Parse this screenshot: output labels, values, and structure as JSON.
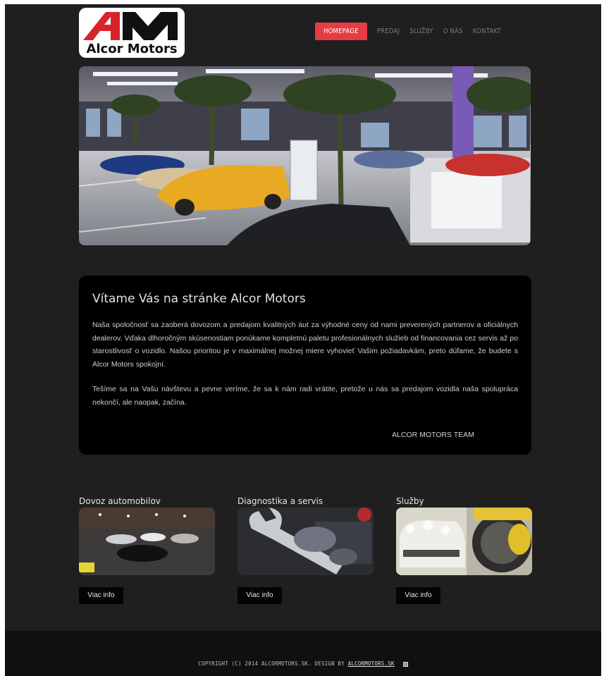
{
  "brand": {
    "logo_text": "Alcor Motors",
    "logo_mark": "AM",
    "accent_color": "#e43c45"
  },
  "nav": {
    "items": [
      {
        "label": "HOMEPAGE",
        "active": true
      },
      {
        "label": "PREDAJ",
        "active": false
      },
      {
        "label": "SLUŽBY",
        "active": false
      },
      {
        "label": "O NÁS",
        "active": false
      },
      {
        "label": "KONTAKT",
        "active": false
      }
    ]
  },
  "welcome": {
    "title": "Vítame Vás na stránke Alcor Motors",
    "paragraph1": "Naša spoločnosť sa zaoberá dovozom a predajom kvalitných áut za výhodné ceny od nami preverených partnerov a oficiálnych dealerov. Vďaka dlhoročným skúsenostiam ponúkame kompletnú paletu profesionálnych služieb od financovania cez servis až po starostlivosť o vozidlo. Našou prioritou je v maximálnej možnej miere vyhovieť Vašim požiadavkám, preto dúfame, že budete s Alcor Motors spokojní.",
    "paragraph2": "Tešíme sa na Vašu návštevu a pevne veríme, že sa k nám radi vrátite, pretože u nás sa predajom vozidla naša spolupráca nekončí, ale naopak, začína.",
    "signature": "ALCOR MOTORS TEAM"
  },
  "cards": [
    {
      "title": "Dovoz automobilov",
      "button": "Viac info"
    },
    {
      "title": "Diagnostika a servis",
      "button": "Viac info"
    },
    {
      "title": "Služby",
      "button": "Viac info"
    }
  ],
  "footer": {
    "text": "COPYRIGHT (C) 2014 ALCORMOTORS.SK. DESIGN BY ",
    "link": "ALCORMOTORS.SK"
  }
}
